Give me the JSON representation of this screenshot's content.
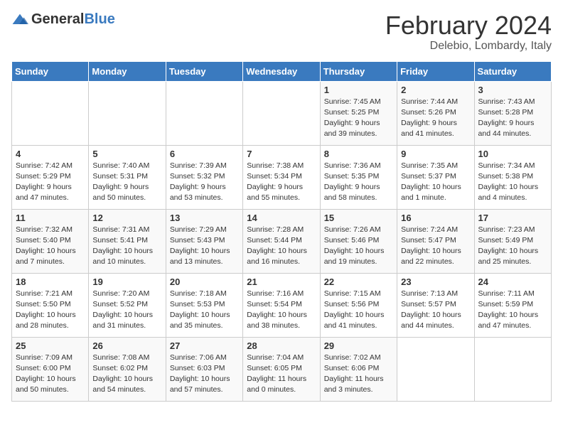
{
  "logo": {
    "general": "General",
    "blue": "Blue"
  },
  "header": {
    "month": "February 2024",
    "location": "Delebio, Lombardy, Italy"
  },
  "weekdays": [
    "Sunday",
    "Monday",
    "Tuesday",
    "Wednesday",
    "Thursday",
    "Friday",
    "Saturday"
  ],
  "weeks": [
    [
      {
        "day": "",
        "info": ""
      },
      {
        "day": "",
        "info": ""
      },
      {
        "day": "",
        "info": ""
      },
      {
        "day": "",
        "info": ""
      },
      {
        "day": "1",
        "info": "Sunrise: 7:45 AM\nSunset: 5:25 PM\nDaylight: 9 hours\nand 39 minutes."
      },
      {
        "day": "2",
        "info": "Sunrise: 7:44 AM\nSunset: 5:26 PM\nDaylight: 9 hours\nand 41 minutes."
      },
      {
        "day": "3",
        "info": "Sunrise: 7:43 AM\nSunset: 5:28 PM\nDaylight: 9 hours\nand 44 minutes."
      }
    ],
    [
      {
        "day": "4",
        "info": "Sunrise: 7:42 AM\nSunset: 5:29 PM\nDaylight: 9 hours\nand 47 minutes."
      },
      {
        "day": "5",
        "info": "Sunrise: 7:40 AM\nSunset: 5:31 PM\nDaylight: 9 hours\nand 50 minutes."
      },
      {
        "day": "6",
        "info": "Sunrise: 7:39 AM\nSunset: 5:32 PM\nDaylight: 9 hours\nand 53 minutes."
      },
      {
        "day": "7",
        "info": "Sunrise: 7:38 AM\nSunset: 5:34 PM\nDaylight: 9 hours\nand 55 minutes."
      },
      {
        "day": "8",
        "info": "Sunrise: 7:36 AM\nSunset: 5:35 PM\nDaylight: 9 hours\nand 58 minutes."
      },
      {
        "day": "9",
        "info": "Sunrise: 7:35 AM\nSunset: 5:37 PM\nDaylight: 10 hours\nand 1 minute."
      },
      {
        "day": "10",
        "info": "Sunrise: 7:34 AM\nSunset: 5:38 PM\nDaylight: 10 hours\nand 4 minutes."
      }
    ],
    [
      {
        "day": "11",
        "info": "Sunrise: 7:32 AM\nSunset: 5:40 PM\nDaylight: 10 hours\nand 7 minutes."
      },
      {
        "day": "12",
        "info": "Sunrise: 7:31 AM\nSunset: 5:41 PM\nDaylight: 10 hours\nand 10 minutes."
      },
      {
        "day": "13",
        "info": "Sunrise: 7:29 AM\nSunset: 5:43 PM\nDaylight: 10 hours\nand 13 minutes."
      },
      {
        "day": "14",
        "info": "Sunrise: 7:28 AM\nSunset: 5:44 PM\nDaylight: 10 hours\nand 16 minutes."
      },
      {
        "day": "15",
        "info": "Sunrise: 7:26 AM\nSunset: 5:46 PM\nDaylight: 10 hours\nand 19 minutes."
      },
      {
        "day": "16",
        "info": "Sunrise: 7:24 AM\nSunset: 5:47 PM\nDaylight: 10 hours\nand 22 minutes."
      },
      {
        "day": "17",
        "info": "Sunrise: 7:23 AM\nSunset: 5:49 PM\nDaylight: 10 hours\nand 25 minutes."
      }
    ],
    [
      {
        "day": "18",
        "info": "Sunrise: 7:21 AM\nSunset: 5:50 PM\nDaylight: 10 hours\nand 28 minutes."
      },
      {
        "day": "19",
        "info": "Sunrise: 7:20 AM\nSunset: 5:52 PM\nDaylight: 10 hours\nand 31 minutes."
      },
      {
        "day": "20",
        "info": "Sunrise: 7:18 AM\nSunset: 5:53 PM\nDaylight: 10 hours\nand 35 minutes."
      },
      {
        "day": "21",
        "info": "Sunrise: 7:16 AM\nSunset: 5:54 PM\nDaylight: 10 hours\nand 38 minutes."
      },
      {
        "day": "22",
        "info": "Sunrise: 7:15 AM\nSunset: 5:56 PM\nDaylight: 10 hours\nand 41 minutes."
      },
      {
        "day": "23",
        "info": "Sunrise: 7:13 AM\nSunset: 5:57 PM\nDaylight: 10 hours\nand 44 minutes."
      },
      {
        "day": "24",
        "info": "Sunrise: 7:11 AM\nSunset: 5:59 PM\nDaylight: 10 hours\nand 47 minutes."
      }
    ],
    [
      {
        "day": "25",
        "info": "Sunrise: 7:09 AM\nSunset: 6:00 PM\nDaylight: 10 hours\nand 50 minutes."
      },
      {
        "day": "26",
        "info": "Sunrise: 7:08 AM\nSunset: 6:02 PM\nDaylight: 10 hours\nand 54 minutes."
      },
      {
        "day": "27",
        "info": "Sunrise: 7:06 AM\nSunset: 6:03 PM\nDaylight: 10 hours\nand 57 minutes."
      },
      {
        "day": "28",
        "info": "Sunrise: 7:04 AM\nSunset: 6:05 PM\nDaylight: 11 hours\nand 0 minutes."
      },
      {
        "day": "29",
        "info": "Sunrise: 7:02 AM\nSunset: 6:06 PM\nDaylight: 11 hours\nand 3 minutes."
      },
      {
        "day": "",
        "info": ""
      },
      {
        "day": "",
        "info": ""
      }
    ]
  ]
}
